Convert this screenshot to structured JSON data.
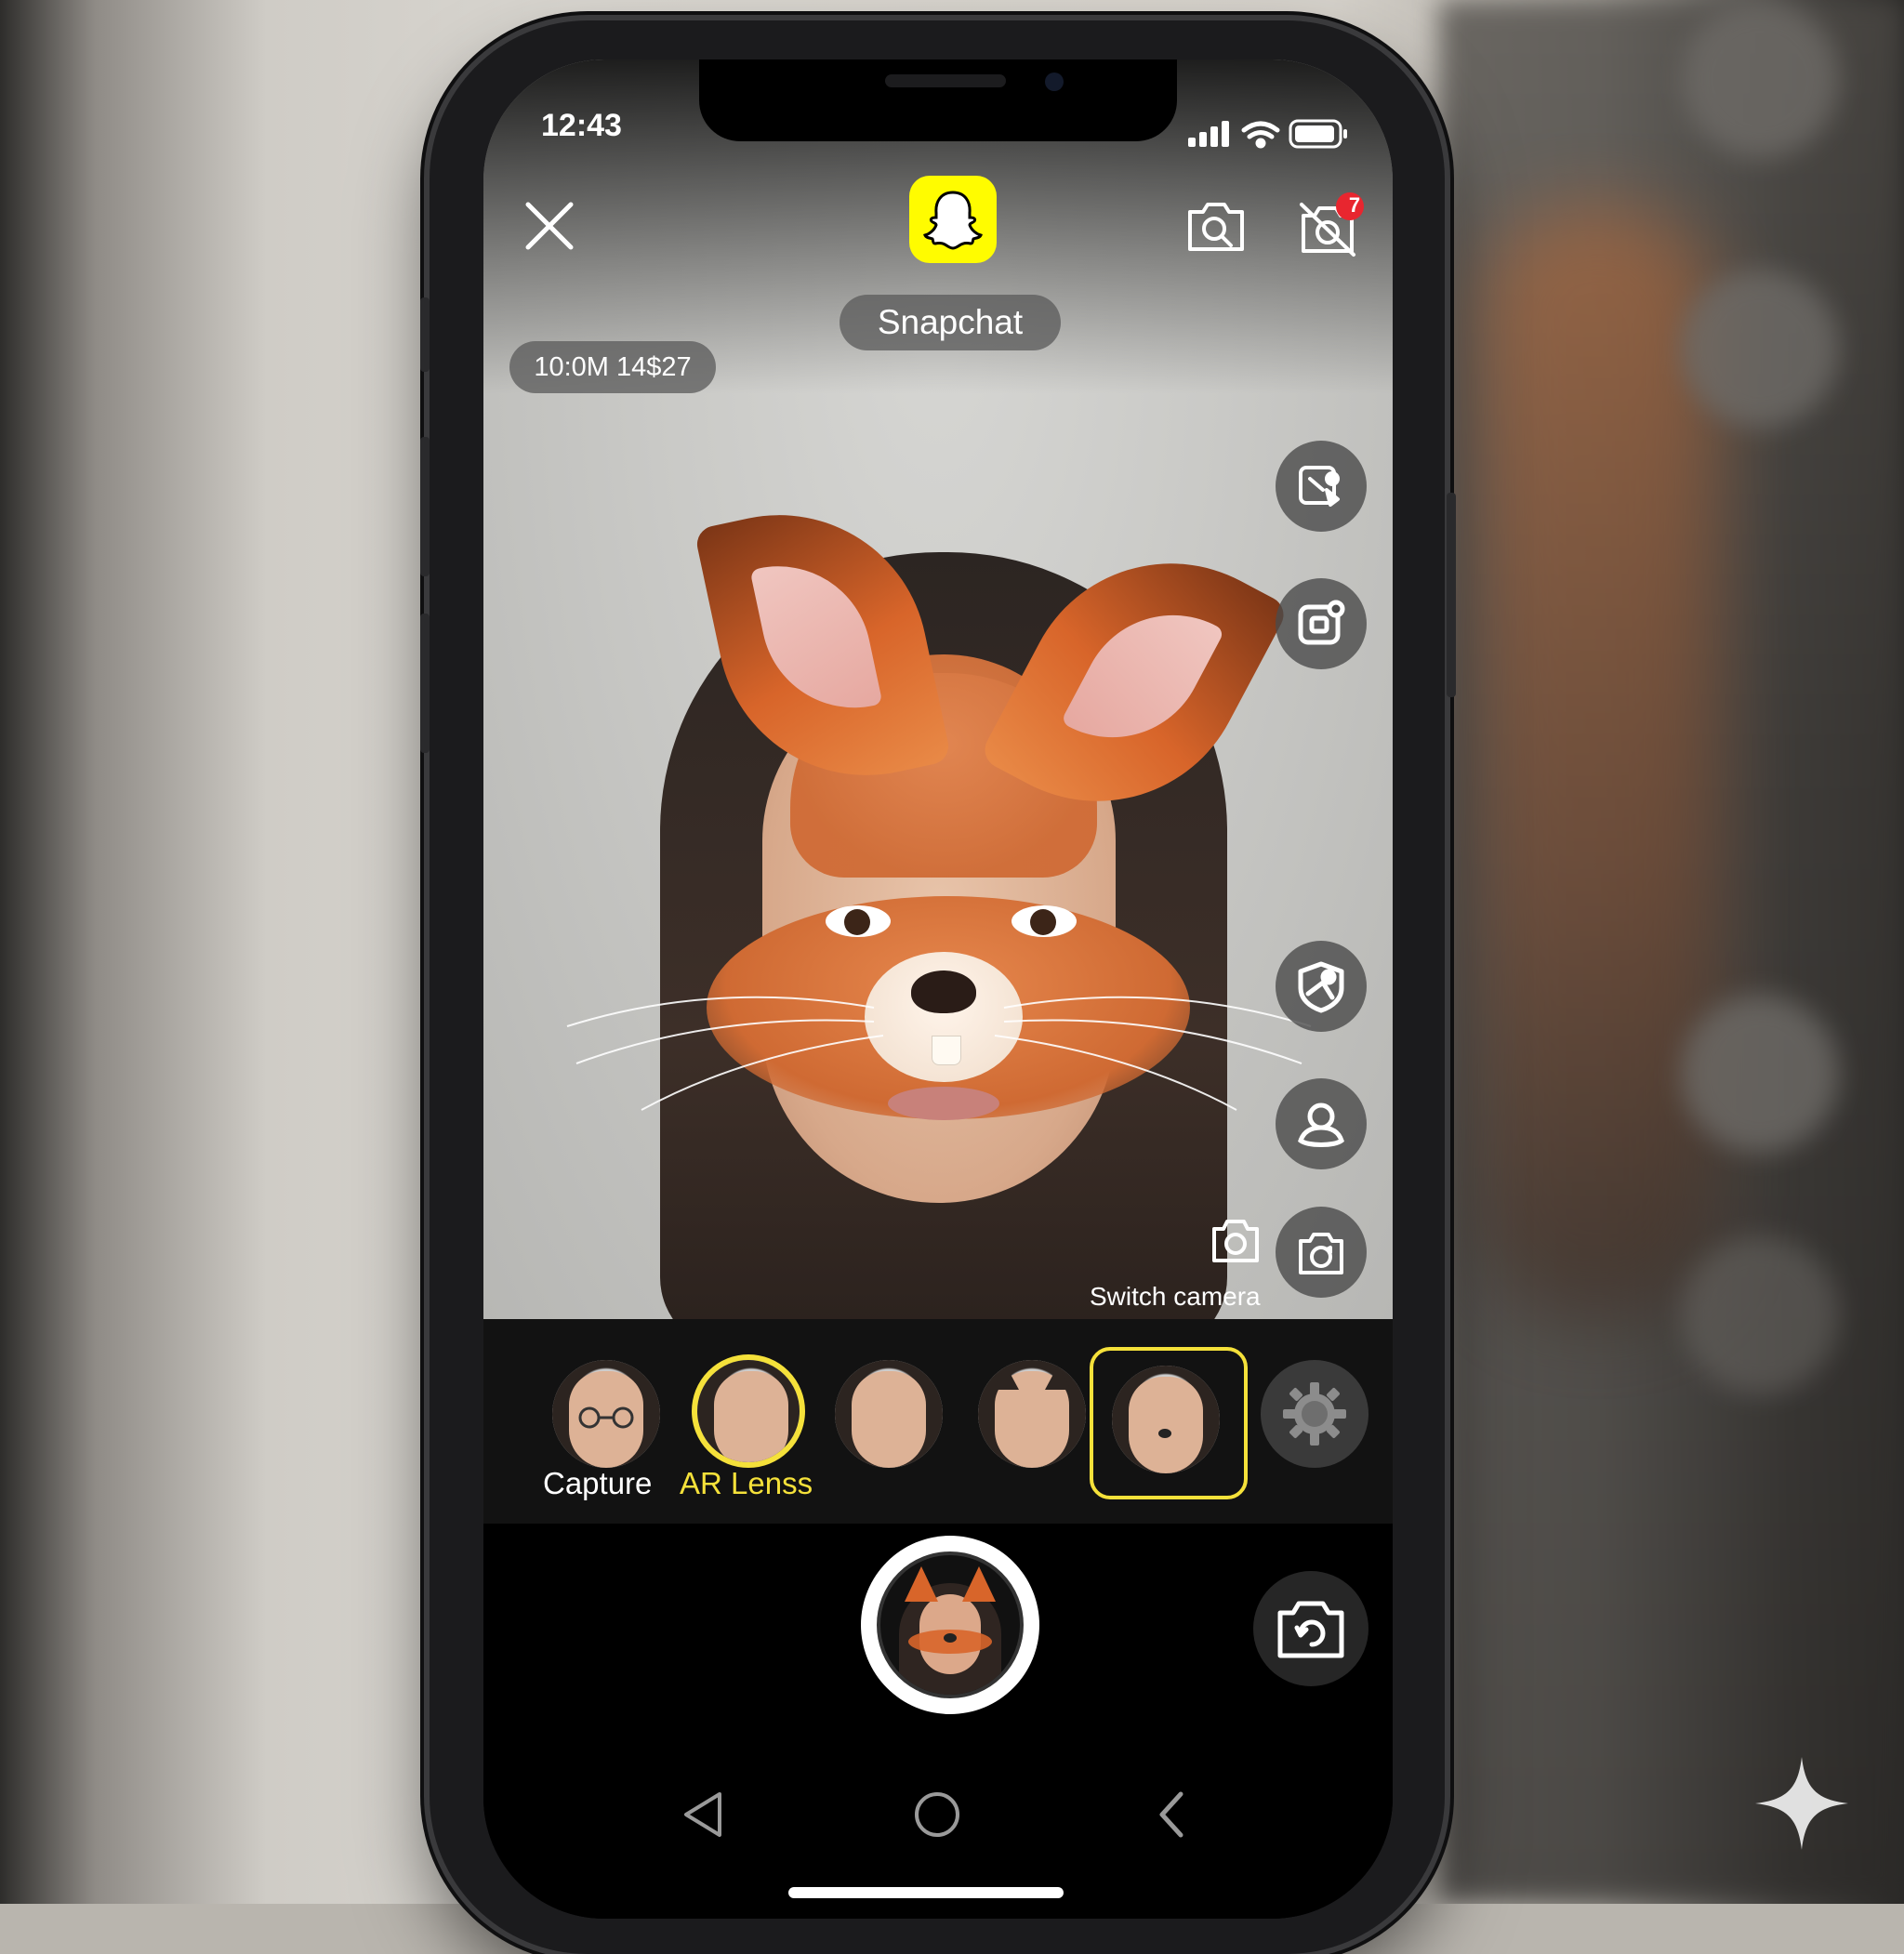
{
  "status_bar": {
    "time": "12:43"
  },
  "header": {
    "close_icon": "close-icon",
    "app_logo": "snapchat-ghost-logo",
    "app_name": "Snapchat",
    "timer_text": "10:0M 14$27",
    "notification_badge": "7"
  },
  "side_tools": [
    {
      "icon": "lens-tools-icon"
    },
    {
      "icon": "camera-frame-icon"
    },
    {
      "icon": "sticker-icon"
    },
    {
      "icon": "face-swap-icon"
    },
    {
      "icon": "switch-camera-icon"
    }
  ],
  "switch_camera_label": "Switch camera",
  "lenses": {
    "labels": {
      "capture": "Capture",
      "ar_lens": "AR Lenss"
    },
    "items": [
      {
        "name": "glasses-lens"
      },
      {
        "name": "ar-lens-selected"
      },
      {
        "name": "natural-face-lens"
      },
      {
        "name": "cat-ears-lens"
      },
      {
        "name": "cat-whiskers-lens"
      },
      {
        "name": "settings-gear"
      }
    ]
  },
  "colors": {
    "accent_yellow": "#f5e13a",
    "snap_yellow": "#fffc00",
    "badge_red": "#e8262f",
    "fox_orange": "#d8652a"
  },
  "nav": {
    "back": "back-icon",
    "home": "home-icon",
    "recents": "recents-icon"
  }
}
